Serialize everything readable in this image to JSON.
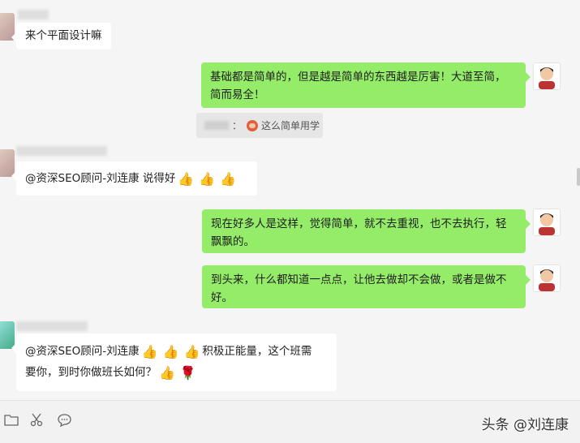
{
  "messages": [
    {
      "side": "left",
      "text": "来个平面设计嘛"
    },
    {
      "side": "right",
      "line1": "基础都是简单的，但是越是简单的东西越是厉害！大道至简，",
      "line2": "简而易全！"
    },
    {
      "side": "left",
      "text": "@资深SEO顾问-刘连康 说得好"
    },
    {
      "side": "right",
      "line1": "现在好多人是这样，觉得简单，就不去重视，也不去执行，轻",
      "line2": "飘飘的。"
    },
    {
      "side": "right",
      "line1": "到头来，什么都知道一点点，让他去做却不会做，或者是做不",
      "line2": "好。"
    },
    {
      "side": "left",
      "line1a": "@资深SEO顾问-刘连康",
      "line1b": "积极正能量，这个班需",
      "line2": "要你，到时你做班长如何？"
    }
  ],
  "quote": {
    "separator": "：",
    "text": "这么简单用学"
  },
  "emoji": {
    "thumbs": "👍",
    "rose": "🌹"
  },
  "watermark": "头条 @刘连康",
  "icons": [
    "folder-icon",
    "scissors-icon",
    "chat-bubble-icon"
  ]
}
